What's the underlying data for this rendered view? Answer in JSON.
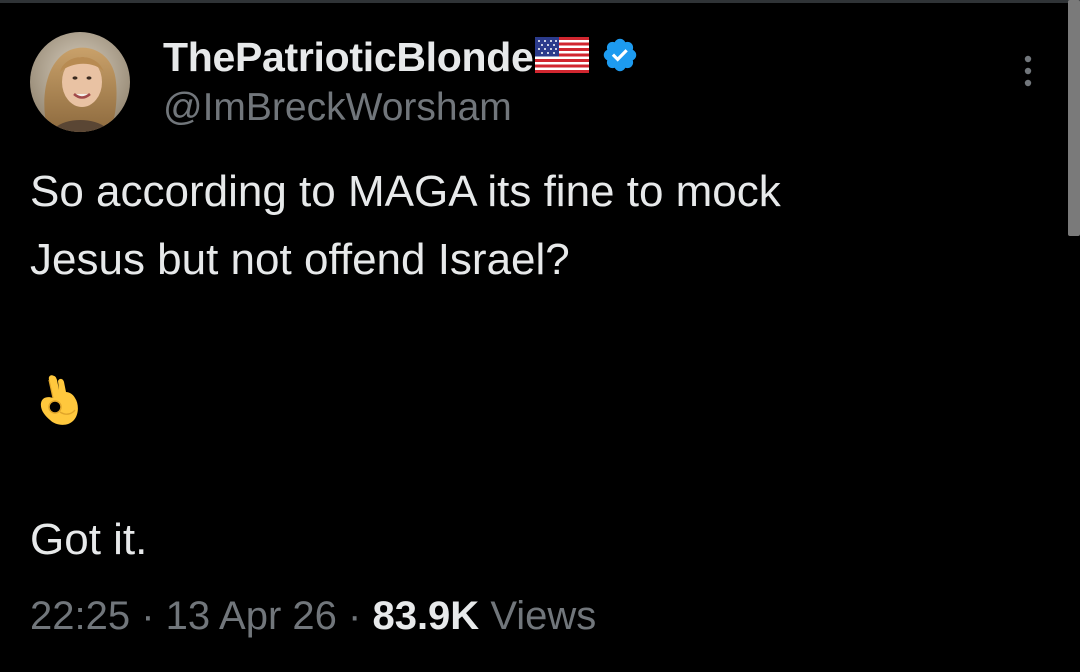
{
  "user": {
    "display_name": "ThePatrioticBlonde",
    "flag_icon": "us-flag-icon",
    "verified_icon": "verified-badge-icon",
    "handle": "@ImBreckWorsham"
  },
  "tweet": {
    "line1": "So according to MAGA its fine to mock",
    "line2": "Jesus but not offend Israel?",
    "emoji_icon": "ok-hand-emoji",
    "line3": "Got it."
  },
  "meta": {
    "time": "22:25",
    "sep1": " · ",
    "date": "13 Apr 26",
    "sep2": " · ",
    "views_count": "83.9K",
    "views_label": " Views"
  },
  "colors": {
    "background": "#000000",
    "text": "#e7e9ea",
    "secondary": "#71767b",
    "verified": "#1d9bf0"
  }
}
